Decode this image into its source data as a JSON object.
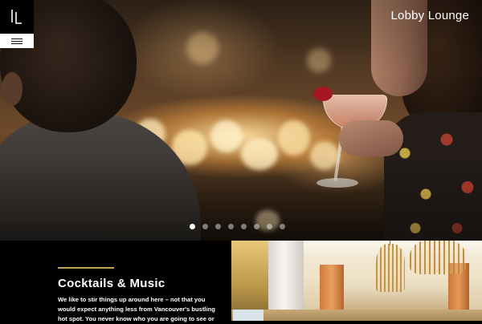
{
  "header": {
    "logo_text": "LL",
    "logo_icon": "ll-monogram-logo",
    "menu_icon": "hamburger-menu-icon",
    "site_title": "Lobby Lounge"
  },
  "hero": {
    "slide_count": 8,
    "active_slide": 1
  },
  "section": {
    "heading": "Cocktails & Music",
    "body": "We like to stir things up around here – not that you would expect anything less from Vancouver's bustling hot spot. You never know who you are going to see or",
    "accent_color": "#c9a24d"
  },
  "colors": {
    "background": "#000000",
    "text": "#ffffff",
    "dot_active": "#ffffff",
    "dot_inactive": "rgba(255,255,255,0.45)"
  }
}
